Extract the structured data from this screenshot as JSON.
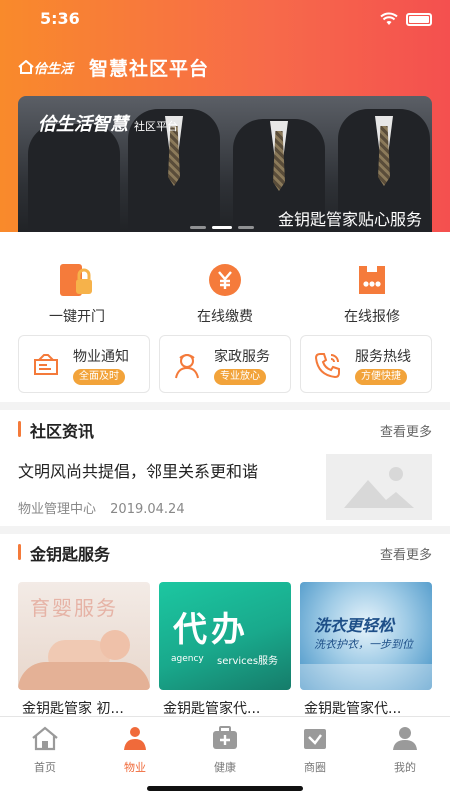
{
  "status_bar": {
    "time": "5:36"
  },
  "header": {
    "logo_text": "佮生活",
    "title": "智慧社区平台"
  },
  "banner": {
    "logo_text": "佮生活智慧",
    "logo_sub": "社区平台",
    "caption": "金钥匙管家贴心服务",
    "slide_count": 3,
    "active_slide": 2
  },
  "quick_actions": [
    {
      "label": "一键开门",
      "icon": "door-lock-icon"
    },
    {
      "label": "在线缴费",
      "icon": "yuan-coin-icon"
    },
    {
      "label": "在线报修",
      "icon": "repair-icon"
    }
  ],
  "services": [
    {
      "name": "物业通知",
      "tag": "全面及时",
      "icon": "notice-icon"
    },
    {
      "name": "家政服务",
      "tag": "专业放心",
      "icon": "housekeeper-icon"
    },
    {
      "name": "服务热线",
      "tag": "方便快捷",
      "icon": "phone-icon"
    }
  ],
  "news_section": {
    "title": "社区资讯",
    "more": "查看更多",
    "item": {
      "title": "文明风尚共提倡，邻里关系更和谐",
      "source": "物业管理中心",
      "date": "2019.04.24"
    }
  },
  "service_section": {
    "title": "金钥匙服务",
    "more": "查看更多",
    "items": [
      {
        "name": "金钥匙管家 初...",
        "art_text": "育婴服务"
      },
      {
        "name": "金钥匙管家代...",
        "art_text": "代办",
        "art_sub_left": "agency",
        "art_sub_right": "services服务"
      },
      {
        "name": "金钥匙管家代...",
        "art_text": "洗衣更轻松",
        "art_sub": "洗衣护衣，一步到位"
      }
    ]
  },
  "tabbar": [
    {
      "label": "首页",
      "icon": "home-icon",
      "active": false
    },
    {
      "label": "物业",
      "icon": "property-icon",
      "active": true
    },
    {
      "label": "健康",
      "icon": "health-icon",
      "active": false
    },
    {
      "label": "商圈",
      "icon": "shopping-icon",
      "active": false
    },
    {
      "label": "我的",
      "icon": "profile-icon",
      "active": false
    }
  ],
  "colors": {
    "accent": "#f47a3a",
    "tag": "#f2a33a",
    "gradient_start": "#f98a2b",
    "gradient_end": "#f4504f"
  }
}
